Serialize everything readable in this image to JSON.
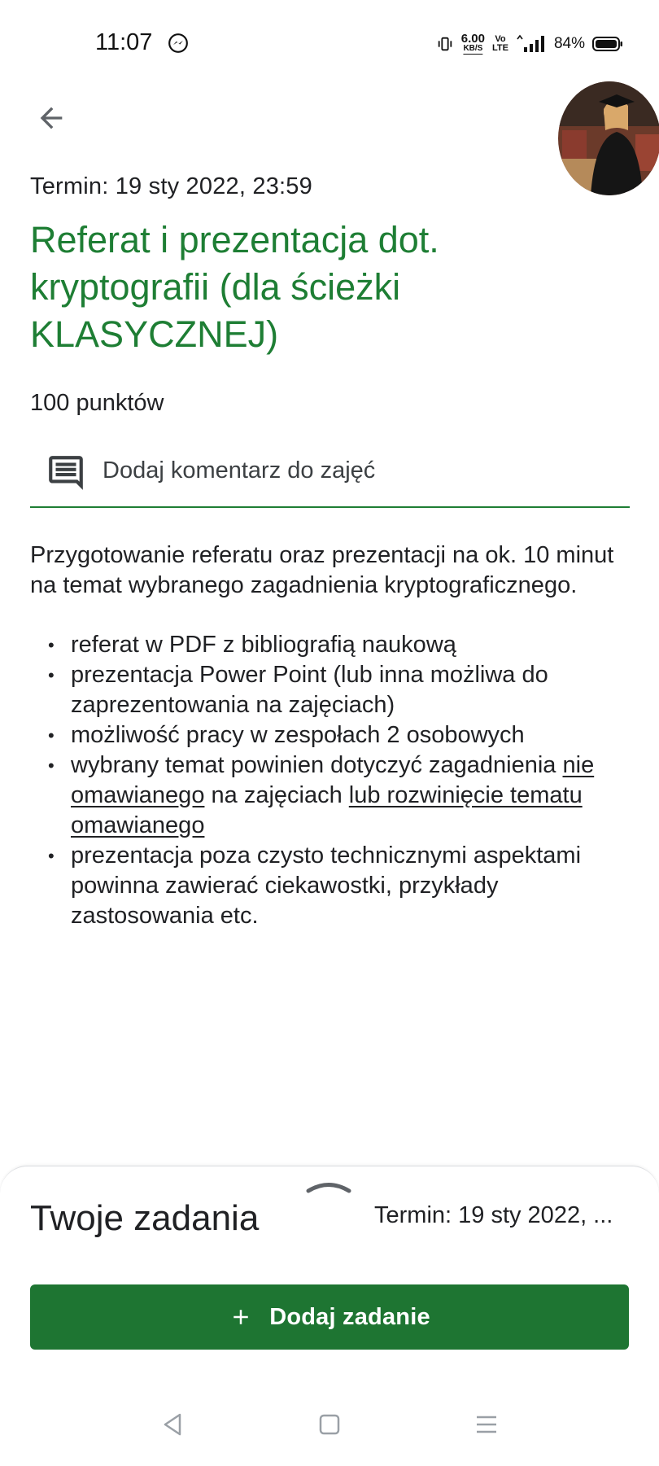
{
  "status_bar": {
    "time": "11:07",
    "speed_value": "6.00",
    "speed_unit": "KB/S",
    "volte_top": "Vo",
    "volte_bottom": "LTE",
    "battery": "84%"
  },
  "header": {
    "due": "Termin: 19 sty 2022, 23:59",
    "title": "Referat i prezentacja dot. kryptografii (dla ścieżki KLASYCZNEJ)",
    "points": "100 punktów",
    "comment_label": "Dodaj komentarz do zajęć"
  },
  "description": {
    "intro": "Przygotowanie referatu oraz prezentacji na ok. 10 minut na temat wybranego zagadnienia kryptograficznego.",
    "bullets": [
      "referat w PDF z bibliografią naukową",
      "prezentacja Power Point (lub inna możliwa do zaprezentowania na zajęciach)",
      "możliwość pracy w zespołach 2 osobowych"
    ],
    "bullet4": {
      "part1": "wybrany temat powinien dotyczyć zagadnienia ",
      "link1": "nie omawianego",
      "part2": " na zajęciach ",
      "link2": "lub rozwinięcie tematu omawianego"
    },
    "bullet5": "prezentacja poza czysto technicznymi aspektami powinna zawierać ciekawostki, przykłady zastosowania etc."
  },
  "sheet": {
    "title": "Twoje zadania",
    "due": "Termin: 19 sty 2022, ...",
    "add_button": "Dodaj zadanie"
  },
  "colors": {
    "accent_green": "#1e7e34",
    "button_green": "#1e7532"
  },
  "icons": {
    "back": "arrow-back-icon",
    "comment": "comment-icon",
    "add": "plus-icon",
    "nav_back": "triangle-back-icon",
    "nav_home": "square-home-icon",
    "nav_menu": "hamburger-menu-icon"
  }
}
